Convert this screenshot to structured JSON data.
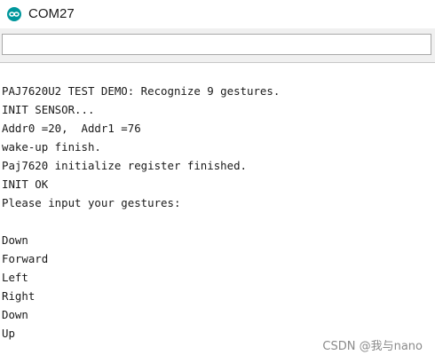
{
  "window": {
    "title": "COM27",
    "icon": "arduino-infinity-icon",
    "accent": "#00979c"
  },
  "send_bar": {
    "value": "",
    "placeholder": ""
  },
  "serial_output": {
    "lines": [
      "PAJ7620U2 TEST DEMO: Recognize 9 gestures.",
      "INIT SENSOR...",
      "Addr0 =20,  Addr1 =76",
      "wake-up finish.",
      "Paj7620 initialize register finished.",
      "INIT OK",
      "Please input your gestures:",
      "",
      "Down",
      "Forward",
      "Left",
      "Right",
      "Down",
      "Up"
    ]
  },
  "watermark": {
    "text": "CSDN @我与nano"
  }
}
